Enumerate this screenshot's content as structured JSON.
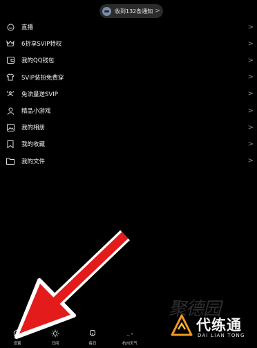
{
  "notification": {
    "label": "收到132条通知",
    "chevron": ">"
  },
  "menu": [
    {
      "label": "直播",
      "icon": "live-icon"
    },
    {
      "label": "6折享SVIP特权",
      "icon": "crown-icon"
    },
    {
      "label": "我的QQ钱包",
      "icon": "wallet-icon"
    },
    {
      "label": "SVIP装扮免费穿",
      "icon": "clothes-icon"
    },
    {
      "label": "免流量送SVIP",
      "icon": "signal-icon"
    },
    {
      "label": "精品小游戏",
      "icon": "person-icon"
    },
    {
      "label": "我的相册",
      "icon": "album-icon"
    },
    {
      "label": "我的收藏",
      "icon": "bookmark-icon"
    },
    {
      "label": "我的文件",
      "icon": "folder-icon"
    }
  ],
  "menu_chevron": ">",
  "bottom_bar": [
    {
      "label": "设置",
      "icon": "settings-icon"
    },
    {
      "label": "日间",
      "icon": "sun-icon"
    },
    {
      "label": "每日",
      "icon": "fruit-icon"
    },
    {
      "label": "杭州天气",
      "icon": "weather-icon",
      "value": "-- °"
    }
  ],
  "watermark": {
    "calligraphy": "聚德园",
    "brand": "代练通",
    "sub": "DAI LIAN TONG"
  },
  "colors": {
    "background": "#000000",
    "arrow": "#e31b1b",
    "logo_orange": "#f39a1e"
  }
}
